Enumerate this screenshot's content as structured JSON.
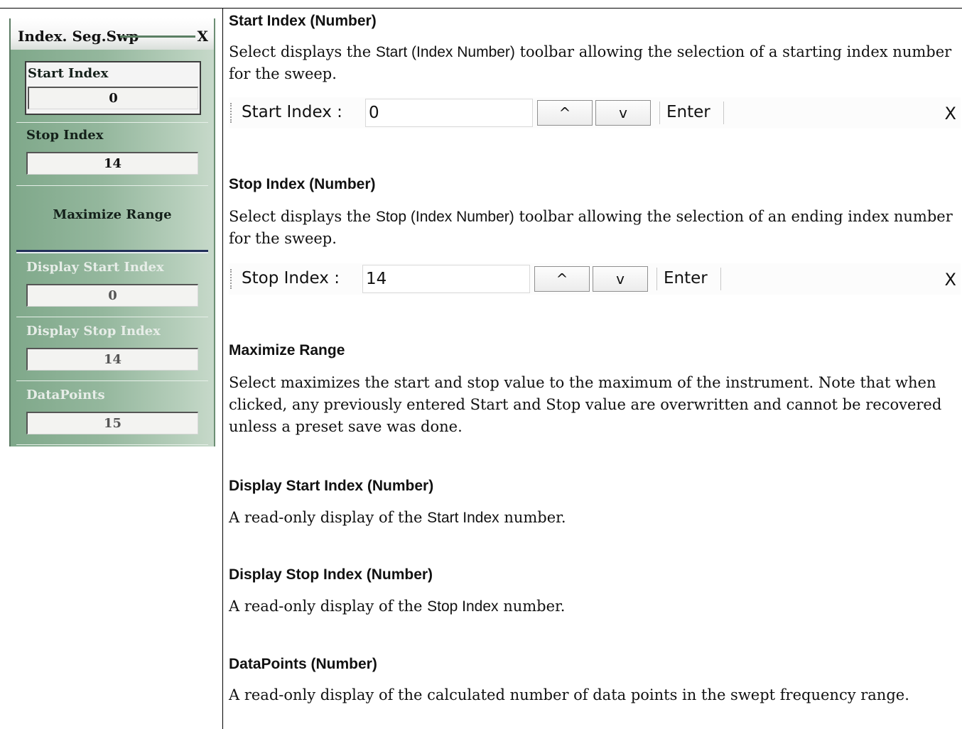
{
  "panel": {
    "title": "Index. Seg.Swp",
    "close": "X",
    "start_index": {
      "label": "Start Index",
      "value": "0"
    },
    "stop_index": {
      "label": "Stop Index",
      "value": "14"
    },
    "maximize": {
      "label": "Maximize Range"
    },
    "display_start": {
      "label": "Display Start Index",
      "value": "0"
    },
    "display_stop": {
      "label": "Display Stop Index",
      "value": "14"
    },
    "datapoints": {
      "label": "DataPoints",
      "value": "15"
    }
  },
  "sections": {
    "start": {
      "heading": "Start Index (Number)",
      "text_a": "Select displays the ",
      "text_b": "Start (Index Number)",
      "text_c": " toolbar allowing the selection of a starting index number for the sweep.",
      "toolbar": {
        "label": "Start Index :",
        "value": "0",
        "up": "^",
        "down": "v",
        "enter": "Enter",
        "close": "X"
      }
    },
    "stop": {
      "heading": "Stop Index (Number)",
      "text_a": "Select displays the ",
      "text_b": "Stop (Index Number)",
      "text_c": " toolbar allowing the selection of an ending index number for the sweep.",
      "toolbar": {
        "label": "Stop Index :",
        "value": "14",
        "up": "^",
        "down": "v",
        "enter": "Enter",
        "close": "X"
      }
    },
    "maximize": {
      "heading": "Maximize Range",
      "text": "Select maximizes the start and stop value to the maximum of the instrument. Note that when clicked, any previously entered Start and Stop value are overwritten and cannot be recovered unless a preset save was done."
    },
    "display_start": {
      "heading": "Display Start Index (Number)",
      "text_a": "A read-only display of the ",
      "text_b": "Start Index",
      "text_c": " number."
    },
    "display_stop": {
      "heading": "Display Stop Index (Number)",
      "text_a": "A read-only display of the ",
      "text_b": "Stop Index",
      "text_c": " number."
    },
    "datapoints": {
      "heading": "DataPoints (Number)",
      "text": "A read-only display of the calculated number of data points in the swept frequency range."
    }
  }
}
